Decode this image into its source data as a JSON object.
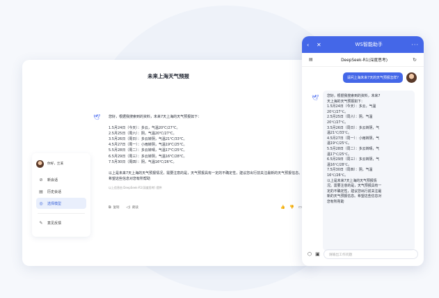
{
  "desktop": {
    "title": "未来上海天气预报",
    "sidebar": {
      "user_name": "你好，兰溪",
      "items": [
        {
          "label": "新会话",
          "icon": "chat-add-icon"
        },
        {
          "label": "历史会话",
          "icon": "history-icon"
        },
        {
          "label": "选择模型",
          "icon": "model-icon",
          "active": true
        }
      ],
      "feedback": {
        "label": "意见反馈",
        "icon": "feedback-icon"
      }
    },
    "answer": {
      "intro": "您好，根据我搜索到的资料，未来7天上海的天气预报如下：",
      "days": [
        "1.5月24日（今天）：多云，气温20℃/27℃。",
        "2.5月25日（周六）：阴，气温20℃/27℃。",
        "3.5月26日（周日）：多云转阴，气温21℃/33℃。",
        "4.5月27日（周一）：小雨转阴，气温19℃/25℃。",
        "5.5月28日（周二）：多云转晴，气温17℃/25℃。",
        "6.5月29日（周三）：多云转阴，气温16℃/28℃。",
        "7.5月30日（周四）：阴，气温16℃/26℃。"
      ],
      "closing": "以上是未来7天上海的天气预报情况，需要注意的是，天气预报具有一定的不确定性，建议您出行前关注最新的天气预报信息。希望这些信息对您有所帮助",
      "ref": "以上信息由 DeepSeek-R1(深度思考) 提供",
      "copy_label": "复制",
      "share_label": "朗读"
    }
  },
  "mobile": {
    "title": "WS智能助手",
    "model": "DeepSeek-R1(深度思考)",
    "question": "请问上海未来7天的天气预报怎样?",
    "answer_lines": [
      "您好，根据我搜索到的资料，未来7",
      "天上海的天气预报如下：",
      "1.5月24日（今天）：多云，气温",
      "20℃/27℃。",
      "2.5月25日（周六）：阴，气温",
      "20℃/27℃。",
      "3.5月26日（周日）：多云转阴，气",
      "温21℃/33℃。",
      "4.5月27日（周一）：小雨转阴，气",
      "温19℃/25℃。",
      "5.5月28日（周二）：多云转晴，气",
      "温17℃/25℃。",
      "6.5月29日（周三）：多云转阴，气",
      "温16℃/28℃。",
      "7.5月30日（周四）：阴，气温",
      "16℃/26℃。",
      "以上是未来7天上海的天气预报情",
      "况。需要注意的是，天气预报具有一",
      "定的不确定性，建议您出行前关注最",
      "新的天气预报信息。希望这些信息对",
      "您有所帮助"
    ],
    "input_placeholder": "请输出工作问题"
  }
}
